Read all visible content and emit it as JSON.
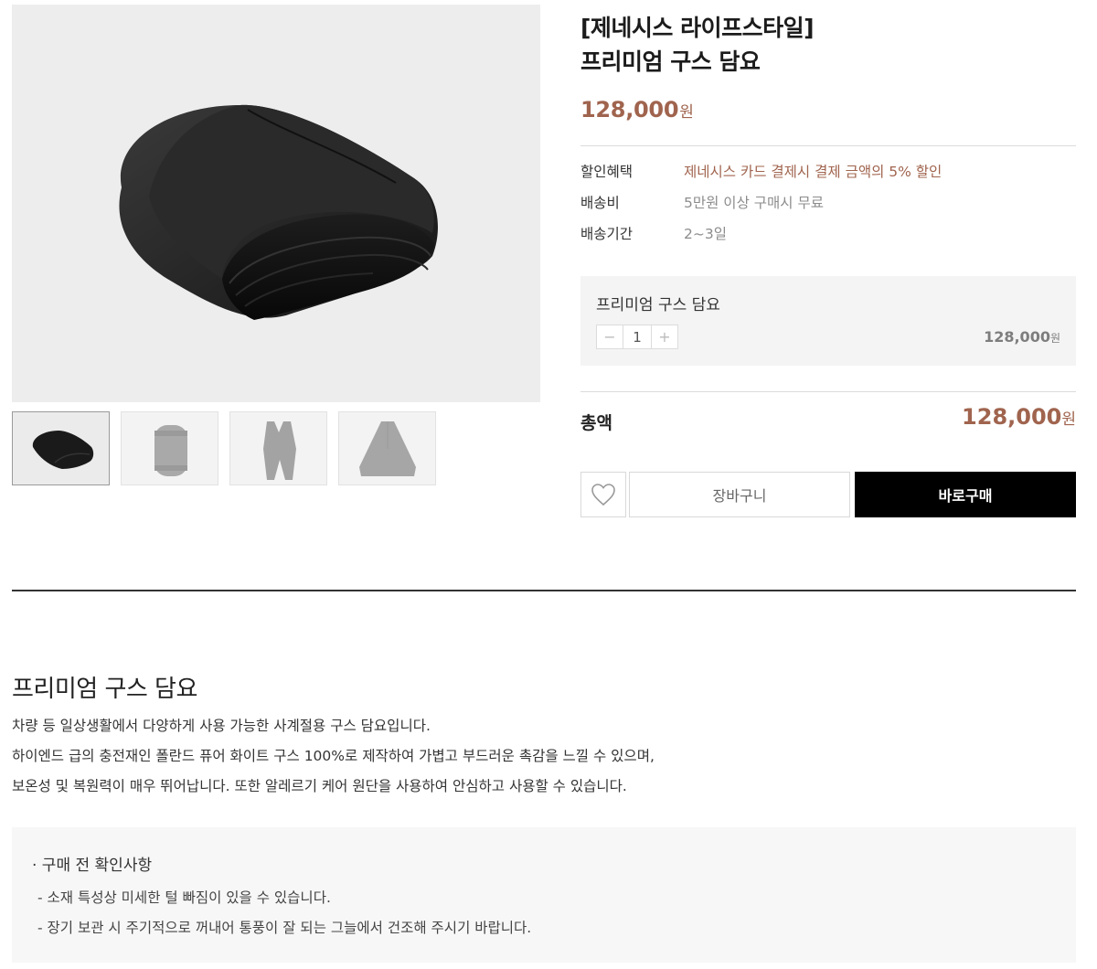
{
  "gallery": {
    "main_image_alt": "",
    "thumbnails": [
      {
        "id": "folded-blanket",
        "active": true
      },
      {
        "id": "rolled-blanket",
        "active": false
      },
      {
        "id": "vest-blanket",
        "active": false
      },
      {
        "id": "cape-blanket",
        "active": false
      }
    ]
  },
  "product": {
    "brand_line": "[제네시스 라이프스타일]",
    "name_line": "프리미엄 구스 담요",
    "price": "128,000",
    "price_unit": "원"
  },
  "specs": [
    {
      "label": "할인혜택",
      "value": "제네시스 카드 결제시 결제 금액의 5% 할인",
      "accent": true
    },
    {
      "label": "배송비",
      "value": "5만원 이상 구매시 무료",
      "accent": false
    },
    {
      "label": "배송기간",
      "value": "2~3일",
      "accent": false
    }
  ],
  "option": {
    "name": "프리미엄 구스 담요",
    "minus": "−",
    "quantity": "1",
    "plus": "+",
    "price": "128,000",
    "price_unit": "원"
  },
  "total": {
    "label": "총액",
    "price": "128,000",
    "price_unit": "원"
  },
  "actions": {
    "wish_icon": "heart-icon",
    "cart_label": "장바구니",
    "buy_label": "바로구매"
  },
  "detail": {
    "title": "프리미엄 구스 담요",
    "lines": [
      "차량 등 일상생활에서 다양하게 사용 가능한 사계절용 구스 담요입니다.",
      "하이엔드 급의 충전재인 폴란드 퓨어 화이트 구스 100%로 제작하여 가볍고 부드러운 촉감을 느낄 수 있으며,",
      "보온성 및 복원력이 매우 뛰어납니다. 또한 알레르기 케어 원단을 사용하여 안심하고 사용할 수 있습니다."
    ]
  },
  "notice": {
    "title": "· 구매 전 확인사항",
    "items": [
      "- 소재 특성상 미세한 털 빠짐이 있을 수 있습니다.",
      "- 장기 보관 시 주기적으로 꺼내어 통풍이 잘 되는 그늘에서 건조해 주시기 바랍니다."
    ]
  },
  "colors": {
    "accent": "#a0644e",
    "buy_button": "#000000",
    "option_bg": "#f4f4f4",
    "notice_bg": "#f7f7f7"
  }
}
